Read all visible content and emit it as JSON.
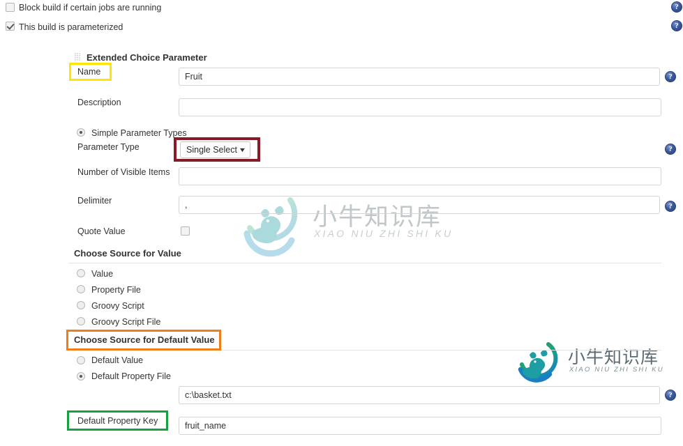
{
  "top_checkboxes": [
    {
      "label": "Block build if certain jobs are running",
      "checked": false
    },
    {
      "label": "This build is parameterized",
      "checked": true
    }
  ],
  "section": {
    "title": "Extended Choice Parameter",
    "grip_icon": "drag-grip-icon"
  },
  "fields": {
    "name": {
      "label": "Name",
      "value": "Fruit"
    },
    "description": {
      "label": "Description",
      "value": ""
    },
    "simple_parameter_types": {
      "label": "Simple Parameter Types",
      "selected": true
    },
    "parameter_type": {
      "label": "Parameter Type",
      "value": "Single Select",
      "arrow": "▼"
    },
    "number_of_visible_items": {
      "label": "Number of Visible Items",
      "value": ""
    },
    "delimiter": {
      "label": "Delimiter",
      "value": ","
    },
    "quote_value": {
      "label": "Quote Value",
      "checked": false
    }
  },
  "choose_source_for_value": {
    "heading": "Choose Source for Value",
    "options": [
      {
        "label": "Value",
        "selected": false
      },
      {
        "label": "Property File",
        "selected": false
      },
      {
        "label": "Groovy Script",
        "selected": false
      },
      {
        "label": "Groovy Script File",
        "selected": false
      }
    ]
  },
  "choose_source_for_default_value": {
    "heading": "Choose Source for Default Value",
    "options": [
      {
        "label": "Default Value",
        "selected": false
      },
      {
        "label": "Default Property File",
        "selected": true
      }
    ],
    "default_property_file": {
      "value": "c:\\basket.txt"
    },
    "default_property_key": {
      "label": "Default Property Key",
      "value": "fruit_name"
    }
  },
  "help_icons": {
    "glyph": "?",
    "name": "help-icon",
    "count": 6
  },
  "highlights": [
    {
      "name": "name-highlight",
      "color": "#ffe600",
      "target": "Name"
    },
    {
      "name": "parameter-type-highlight",
      "color": "#8b1a27",
      "target": "Single Select"
    },
    {
      "name": "choose-source-default-highlight",
      "color": "#f07d1a",
      "target": "Choose Source for Default Value"
    },
    {
      "name": "default-property-key-highlight",
      "color": "#19a13f",
      "target": "Default Property Key"
    }
  ],
  "watermarks": [
    {
      "cn": "小牛知识库",
      "en": "XIAO NIU ZHI SHI KU",
      "logo": "bull-logo-icon",
      "variant": "faint"
    },
    {
      "cn": "小牛知识库",
      "en": "XIAO NIU ZHI SHI KU",
      "logo": "bull-logo-icon",
      "variant": "solid"
    }
  ],
  "colors": {
    "highlight_yellow": "#ffe600",
    "highlight_maroon": "#8b1a27",
    "highlight_orange": "#f07d1a",
    "highlight_green": "#19a13f",
    "help_blue": "#39589f",
    "text": "#333333",
    "border": "#d4d4d4"
  }
}
